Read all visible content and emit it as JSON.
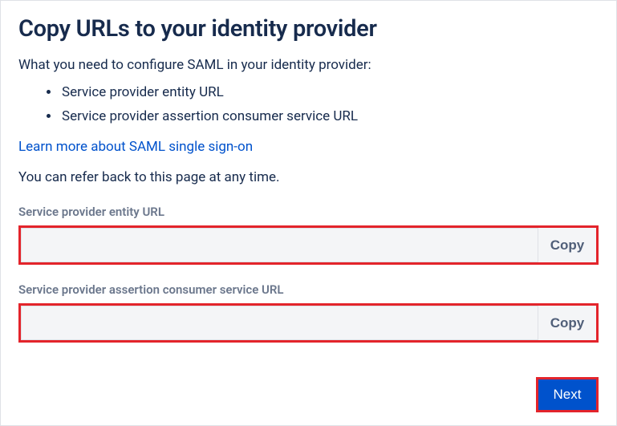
{
  "heading": "Copy URLs to your identity provider",
  "intro": "What you need to configure SAML in your identity provider:",
  "bullets": {
    "item1": "Service provider entity URL",
    "item2": "Service provider assertion consumer service URL"
  },
  "learnMoreLink": "Learn more about SAML single sign-on",
  "referBack": "You can refer back to this page at any time.",
  "fields": {
    "entity": {
      "label": "Service provider entity URL",
      "value": "",
      "copyLabel": "Copy"
    },
    "acs": {
      "label": "Service provider assertion consumer service URL",
      "value": "",
      "copyLabel": "Copy"
    }
  },
  "nextLabel": "Next"
}
